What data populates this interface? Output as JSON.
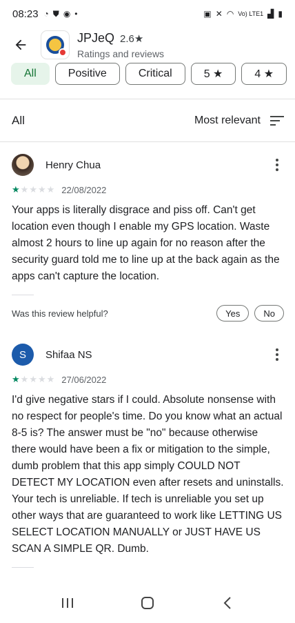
{
  "status_bar": {
    "time": "08:23",
    "right_text": "Vo) LTE1"
  },
  "header": {
    "app_name": "JPJeQ",
    "rating": "2.6",
    "subtitle": "Ratings and reviews"
  },
  "filters": {
    "chips": [
      {
        "label": "All",
        "active": true
      },
      {
        "label": "Positive",
        "active": false
      },
      {
        "label": "Critical",
        "active": false
      },
      {
        "label": "5 ★",
        "active": false
      },
      {
        "label": "4 ★",
        "active": false
      }
    ]
  },
  "sort": {
    "label": "All",
    "mode": "Most relevant"
  },
  "reviews": [
    {
      "name": "Henry Chua",
      "avatar": "photo",
      "stars": 1,
      "date": "22/08/2022",
      "text": "Your apps is literally disgrace and piss off. Can't get location even though I enable my GPS location. Waste almost 2 hours to line up again for no reason after the security guard told me to line up at the back again as the apps can't capture the location.",
      "helpful_label": "Was this review helpful?",
      "yes_label": "Yes",
      "no_label": "No"
    },
    {
      "name": "Shifaa NS",
      "avatar_letter": "S",
      "stars": 1,
      "date": "27/06/2022",
      "text": "I'd give negative stars if I could. Absolute nonsense with no respect for people's time. Do you know what an actual 8-5 is? The answer must be \"no\" because otherwise there would have been a fix or mitigation to the simple, dumb problem that this app simply COULD NOT DETECT MY LOCATION even after resets and uninstalls. Your tech is unreliable. If tech is unreliable you set up other ways that are guaranteed to work like LETTING US SELECT LOCATION MANUALLY or JUST HAVE US SCAN A SIMPLE QR. Dumb."
    }
  ],
  "colors": {
    "accent_green": "#01875f",
    "chip_active_bg": "#e6f4ea",
    "avatar_blue": "#1c5bab"
  }
}
